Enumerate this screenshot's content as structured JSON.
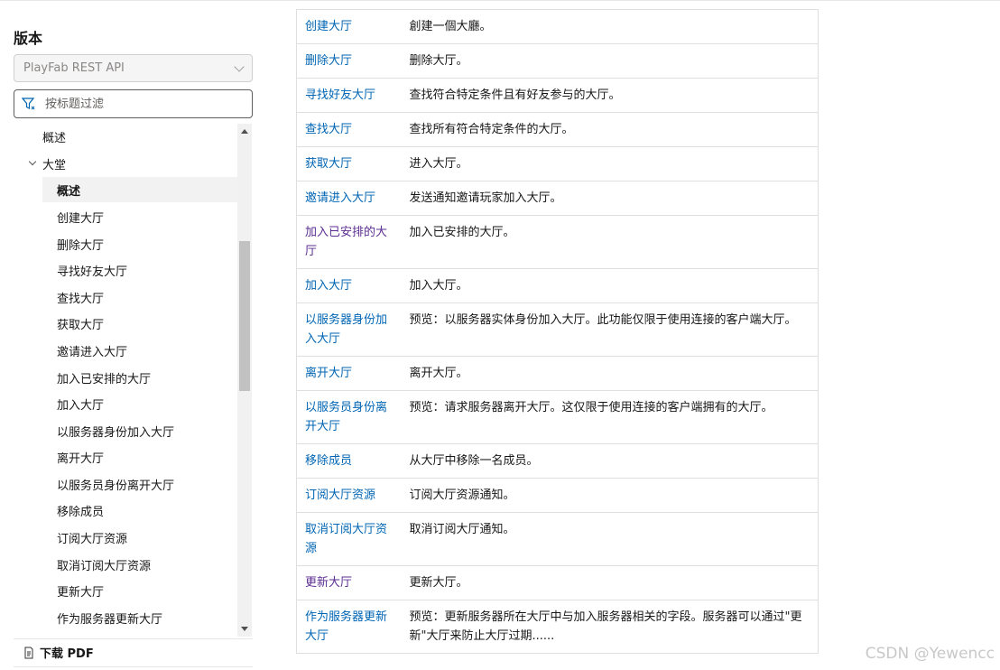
{
  "sidebar": {
    "version_heading": "版本",
    "version_select": "PlayFab REST API",
    "filter_placeholder": "按标题过滤",
    "toc": {
      "overview_top": "概述",
      "lobby_group": "大堂",
      "items": [
        "概述",
        "创建大厅",
        "删除大厅",
        "寻找好友大厅",
        "查找大厅",
        "获取大厅",
        "邀请进入大厅",
        "加入已安排的大厅",
        "加入大厅",
        "以服务器身份加入大厅",
        "离开大厅",
        "以服务员身份离开大厅",
        "移除成员",
        "订阅大厅资源",
        "取消订阅大厅资源",
        "更新大厅",
        "作为服务器更新大厅"
      ]
    },
    "download_pdf": "下载 PDF"
  },
  "table": {
    "rows": [
      {
        "name": "创建大厅",
        "desc": "創建一個大廳。"
      },
      {
        "name": "删除大厅",
        "desc": "删除大厅。"
      },
      {
        "name": "寻找好友大厅",
        "desc": "查找符合特定条件且有好友参与的大厅。"
      },
      {
        "name": "查找大厅",
        "desc": "查找所有符合特定条件的大厅。"
      },
      {
        "name": "获取大厅",
        "desc": "进入大厅。"
      },
      {
        "name": "邀请进入大厅",
        "desc": "发送通知邀请玩家加入大厅。"
      },
      {
        "name": "加入已安排的大厅",
        "desc": "加入已安排的大厅。"
      },
      {
        "name": "加入大厅",
        "desc": "加入大厅。"
      },
      {
        "name": "以服务器身份加入大厅",
        "desc": "预览：以服务器实体身份加入大厅。此功能仅限于使用连接的客户端大厅。"
      },
      {
        "name": "离开大厅",
        "desc": "离开大厅。"
      },
      {
        "name": "以服务员身份离开大厅",
        "desc": "预览：请求服务器离开大厅。这仅限于使用连接的客户端拥有的大厅。"
      },
      {
        "name": "移除成员",
        "desc": "从大厅中移除一名成员。"
      },
      {
        "name": "订阅大厅资源",
        "desc": "订阅大厅资源通知。"
      },
      {
        "name": "取消订阅大厅资源",
        "desc": "取消订阅大厅通知。"
      },
      {
        "name": "更新大厅",
        "desc": "更新大厅。"
      },
      {
        "name": "作为服务器更新大厅",
        "desc": "预览：更新服务器所在大厅中与加入服务器相关的字段。服务器可以通过\"更新\"大厅来防止大厅过期......"
      }
    ]
  },
  "watermark": "CSDN @Yewencc",
  "colors": {
    "link": "#0065b3",
    "visited_link": "#5c2d91",
    "border": "#e1dfdd"
  }
}
